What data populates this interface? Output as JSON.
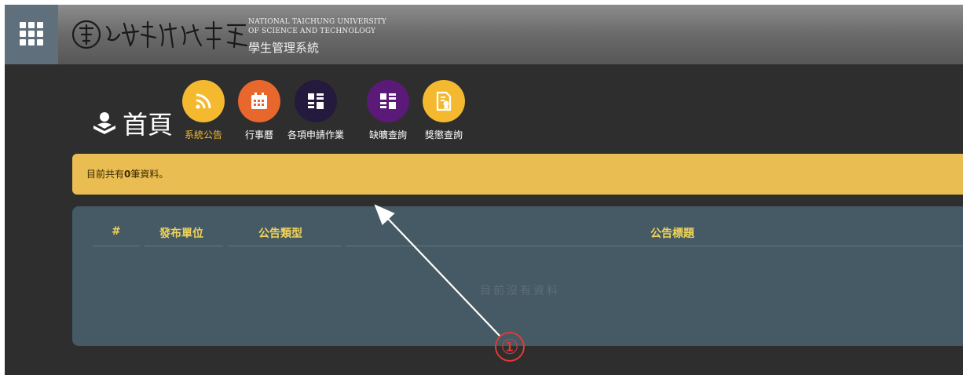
{
  "header": {
    "logo_en_line1": "NATIONAL TAICHUNG UNIVERSITY",
    "logo_en_line2": "OF SCIENCE AND TECHNOLOGY",
    "system_name": "學生管理系統"
  },
  "home": {
    "title": "首頁"
  },
  "quick_links": [
    {
      "label": "系統公告",
      "icon": "rss-icon",
      "color": "#f4b92f",
      "active": true
    },
    {
      "label": "行事曆",
      "icon": "calendar-icon",
      "color": "#e8672d"
    },
    {
      "label": "各項申請作業",
      "icon": "grid-icon",
      "color": "#241a3d"
    },
    {
      "label": "缺曠查詢",
      "icon": "grid-icon",
      "color": "#5b1a78"
    },
    {
      "label": "獎懲查詢",
      "icon": "certificate-icon",
      "color": "#f4b92f"
    }
  ],
  "alert": {
    "prefix": "目前共有",
    "count": "0",
    "suffix": "筆資料。"
  },
  "table": {
    "columns": [
      "#",
      "發布單位",
      "公告類型",
      "公告標題"
    ],
    "empty_message": "目前沒有資料"
  },
  "annotation": {
    "marker": "①"
  },
  "colors": {
    "header_accent": "#f0d35a",
    "alert_bg": "#eabd52",
    "panel_bg": "#455a64",
    "active_link": "#f4b92f"
  }
}
